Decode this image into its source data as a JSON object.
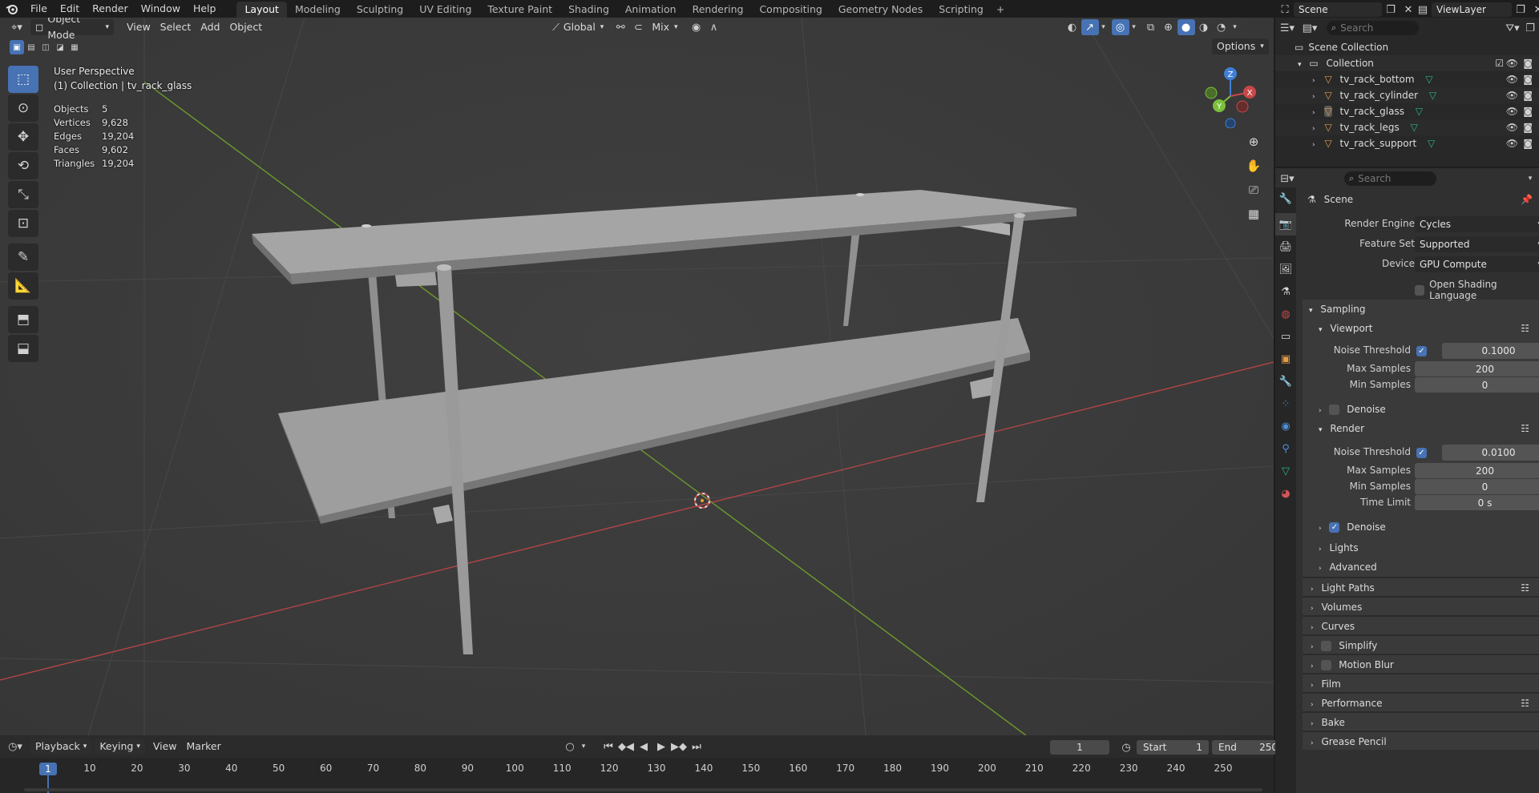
{
  "menu": [
    "File",
    "Edit",
    "Render",
    "Window",
    "Help"
  ],
  "workspaces": [
    "Layout",
    "Modeling",
    "Sculpting",
    "UV Editing",
    "Texture Paint",
    "Shading",
    "Animation",
    "Rendering",
    "Compositing",
    "Geometry Nodes",
    "Scripting"
  ],
  "active_workspace": "Layout",
  "scene_name": "Scene",
  "view_layer": "ViewLayer",
  "viewport_header": {
    "mode": "Object Mode",
    "menus": [
      "View",
      "Select",
      "Add",
      "Object"
    ],
    "orientation": "Global",
    "snap_target": "Mix",
    "options_label": "Options"
  },
  "overlay": {
    "view_name": "User Perspective",
    "collection_line": "(1) Collection | tv_rack_glass",
    "stats": [
      {
        "key": "Objects",
        "value": "5"
      },
      {
        "key": "Vertices",
        "value": "9,628"
      },
      {
        "key": "Edges",
        "value": "19,204"
      },
      {
        "key": "Faces",
        "value": "9,602"
      },
      {
        "key": "Triangles",
        "value": "19,204"
      }
    ]
  },
  "gizmo": {
    "z": "Z",
    "y": "Y",
    "x": "X"
  },
  "colors": {
    "accent": "#4772b3",
    "x_axis": "#c84848",
    "y_axis": "#7bbf3c",
    "z_axis": "#3f7fd6",
    "object_icon": "#e49b45",
    "mesh_data_icon": "#29b38f"
  },
  "timeline": {
    "menus": [
      "Playback",
      "Keying",
      "View",
      "Marker"
    ],
    "current_frame": "1",
    "start_label": "Start",
    "start_value": "1",
    "end_label": "End",
    "end_value": "250",
    "ticks": [
      "1",
      "10",
      "20",
      "30",
      "40",
      "50",
      "60",
      "70",
      "80",
      "90",
      "100",
      "110",
      "120",
      "130",
      "140",
      "150",
      "160",
      "170",
      "180",
      "190",
      "200",
      "210",
      "220",
      "230",
      "240",
      "250"
    ]
  },
  "outliner": {
    "search_placeholder": "Search",
    "scene_collection": "Scene Collection",
    "collection": "Collection",
    "objects": [
      "tv_rack_bottom",
      "tv_rack_cylinder",
      "tv_rack_glass",
      "tv_rack_legs",
      "tv_rack_support"
    ]
  },
  "properties": {
    "search_placeholder": "Search",
    "context": "Scene",
    "render_engine_label": "Render Engine",
    "render_engine": "Cycles",
    "feature_set_label": "Feature Set",
    "feature_set": "Supported",
    "device_label": "Device",
    "device": "GPU Compute",
    "osl_label": "Open Shading Language",
    "sampling": "Sampling",
    "viewport": {
      "title": "Viewport",
      "noise_threshold_label": "Noise Threshold",
      "noise_threshold": "0.1000",
      "max_samples_label": "Max Samples",
      "max_samples": "200",
      "min_samples_label": "Min Samples",
      "min_samples": "0",
      "denoise_label": "Denoise"
    },
    "render": {
      "title": "Render",
      "noise_threshold_label": "Noise Threshold",
      "noise_threshold": "0.0100",
      "max_samples_label": "Max Samples",
      "max_samples": "200",
      "min_samples_label": "Min Samples",
      "min_samples": "0",
      "time_limit_label": "Time Limit",
      "time_limit": "0 s",
      "denoise_label": "Denoise"
    },
    "sampling_subpanels": [
      "Lights",
      "Advanced"
    ],
    "panels": [
      "Light Paths",
      "Volumes",
      "Curves",
      "Simplify",
      "Motion Blur",
      "Film",
      "Performance",
      "Bake",
      "Grease Pencil"
    ]
  }
}
